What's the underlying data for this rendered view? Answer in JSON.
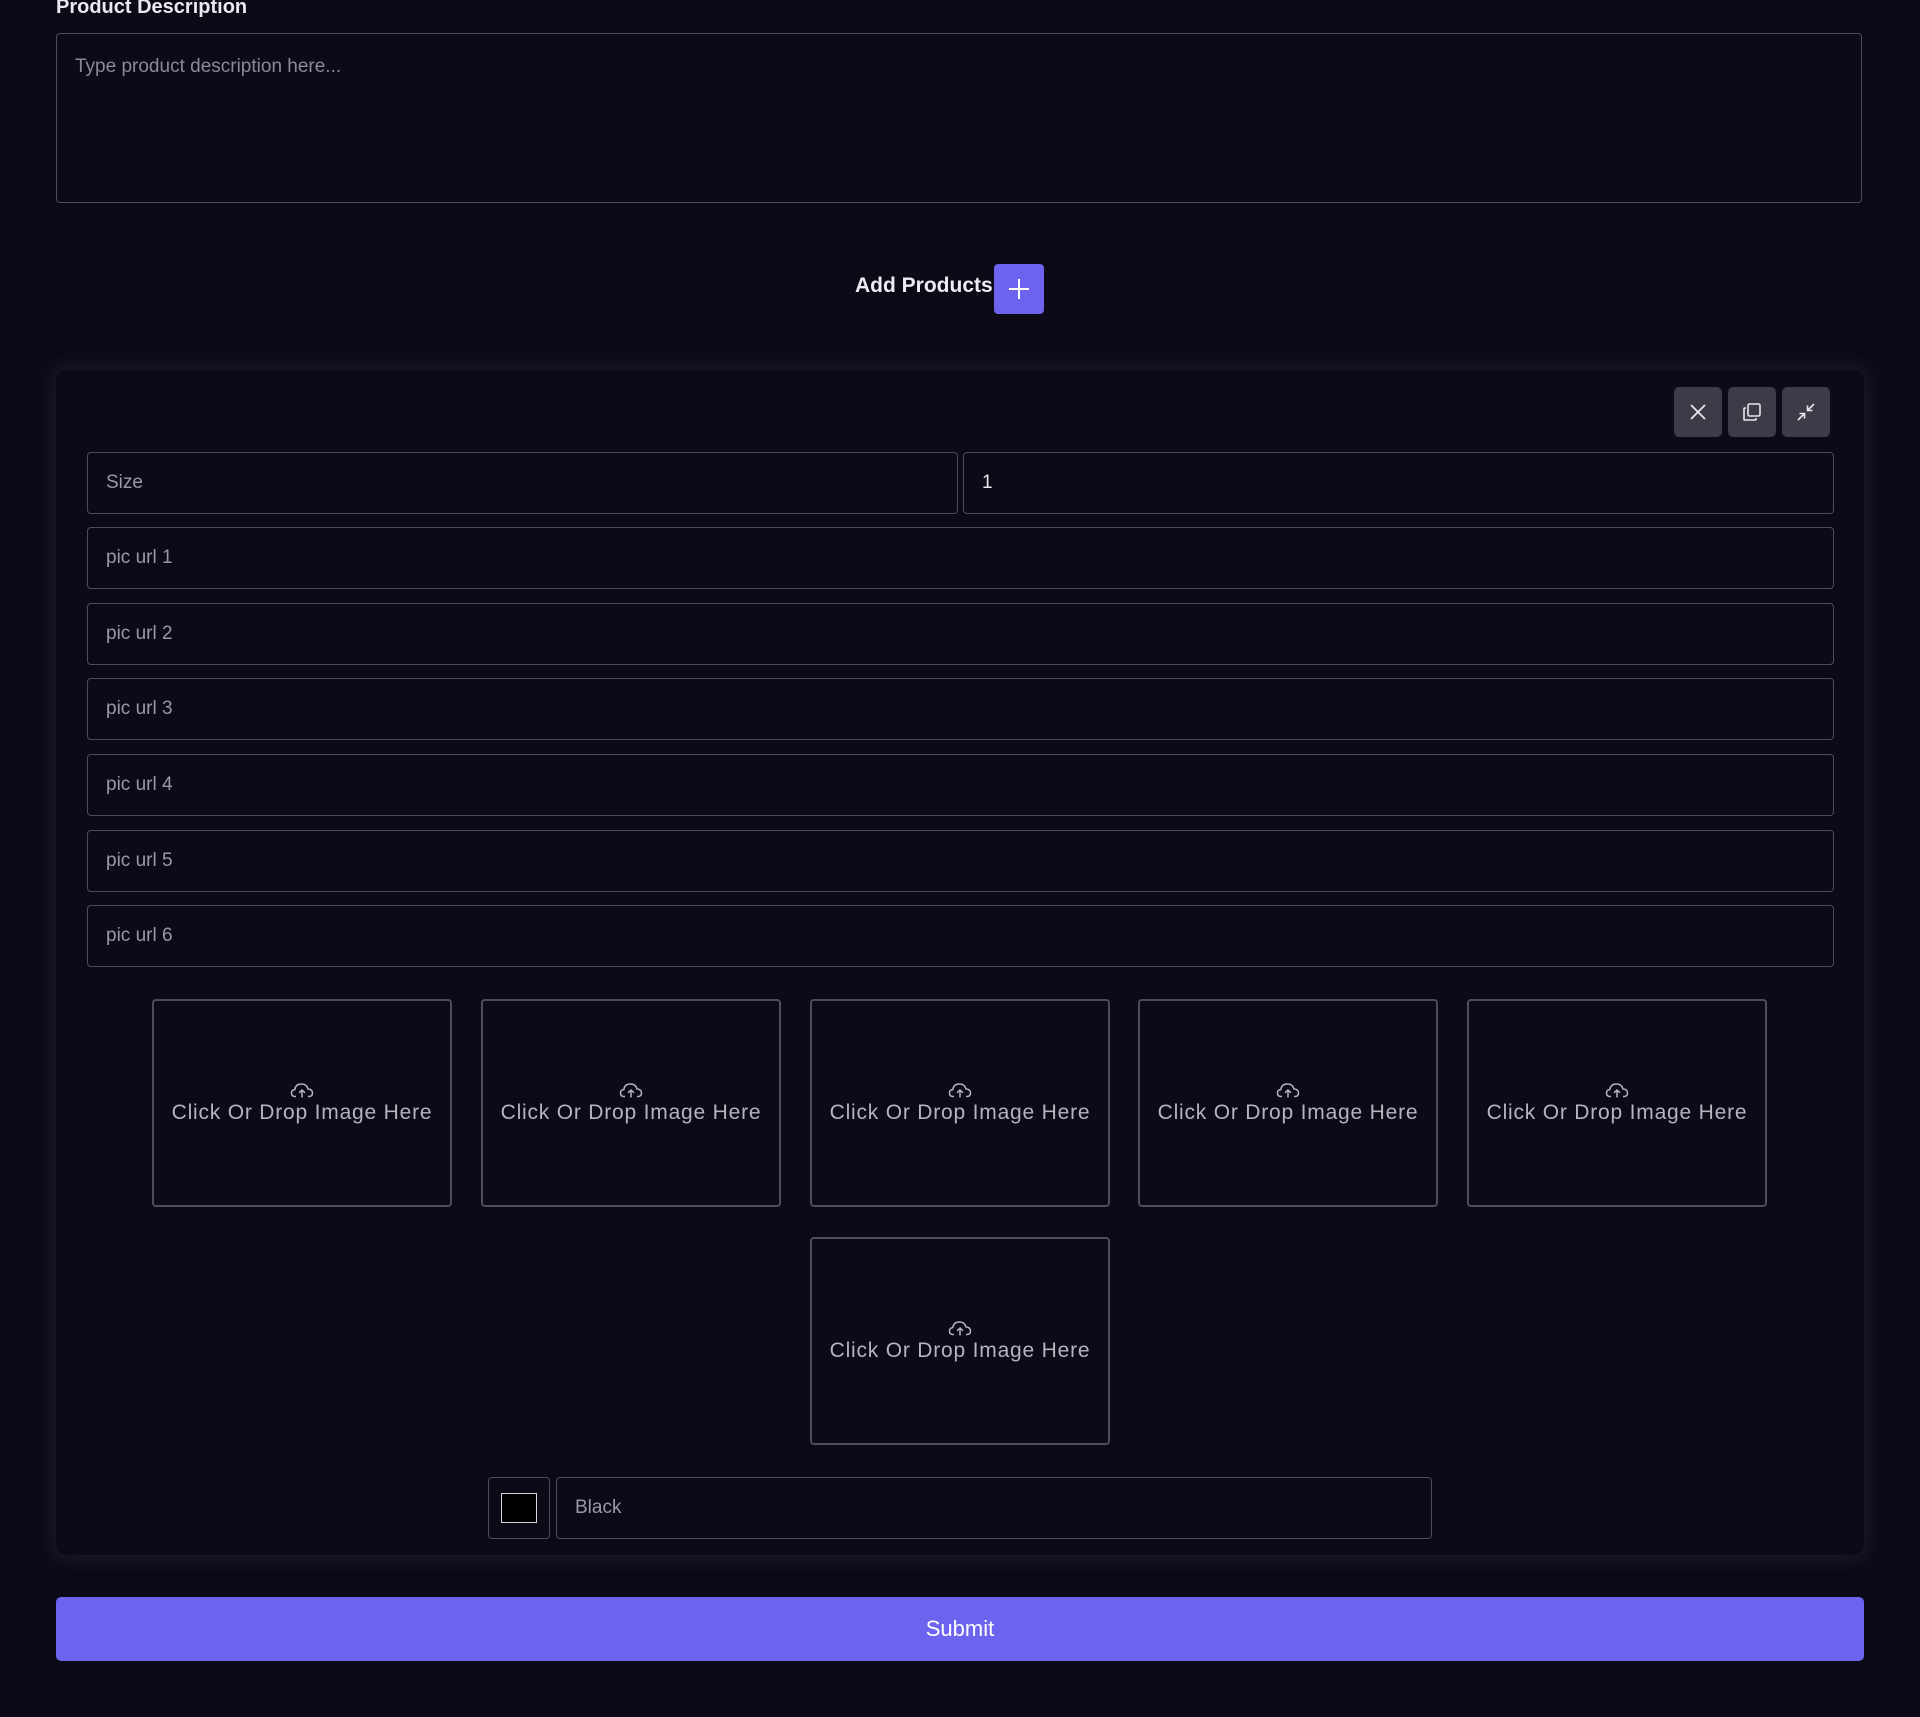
{
  "description": {
    "label": "Product Description",
    "placeholder": "Type product description here..."
  },
  "add_products": {
    "label": "Add Products",
    "button_icon": "plus-icon"
  },
  "product_card": {
    "actions": [
      {
        "name": "remove",
        "icon": "close-icon"
      },
      {
        "name": "duplicate",
        "icon": "copy-icon"
      },
      {
        "name": "collapse",
        "icon": "minimize-icon"
      }
    ],
    "size_placeholder": "Size",
    "quantity_value": "1",
    "pic_urls": [
      {
        "placeholder": "pic url 1"
      },
      {
        "placeholder": "pic url 2"
      },
      {
        "placeholder": "pic url 3"
      },
      {
        "placeholder": "pic url 4"
      },
      {
        "placeholder": "pic url 5"
      },
      {
        "placeholder": "pic url 6"
      }
    ],
    "dropzones": [
      {
        "text": "Click Or Drop Image Here",
        "icon": "cloud-upload-icon"
      },
      {
        "text": "Click Or Drop Image Here",
        "icon": "cloud-upload-icon"
      },
      {
        "text": "Click Or Drop Image Here",
        "icon": "cloud-upload-icon"
      },
      {
        "text": "Click Or Drop Image Here",
        "icon": "cloud-upload-icon"
      },
      {
        "text": "Click Or Drop Image Here",
        "icon": "cloud-upload-icon"
      },
      {
        "text": "Click Or Drop Image Here",
        "icon": "cloud-upload-icon"
      }
    ],
    "color": {
      "swatch": "#000000",
      "name_placeholder": "Black"
    }
  },
  "submit": {
    "label": "Submit"
  },
  "colors": {
    "background": "#0b0a16",
    "accent": "#6c63ef",
    "border": "#4d4c58",
    "action_button": "#3c3c48"
  }
}
